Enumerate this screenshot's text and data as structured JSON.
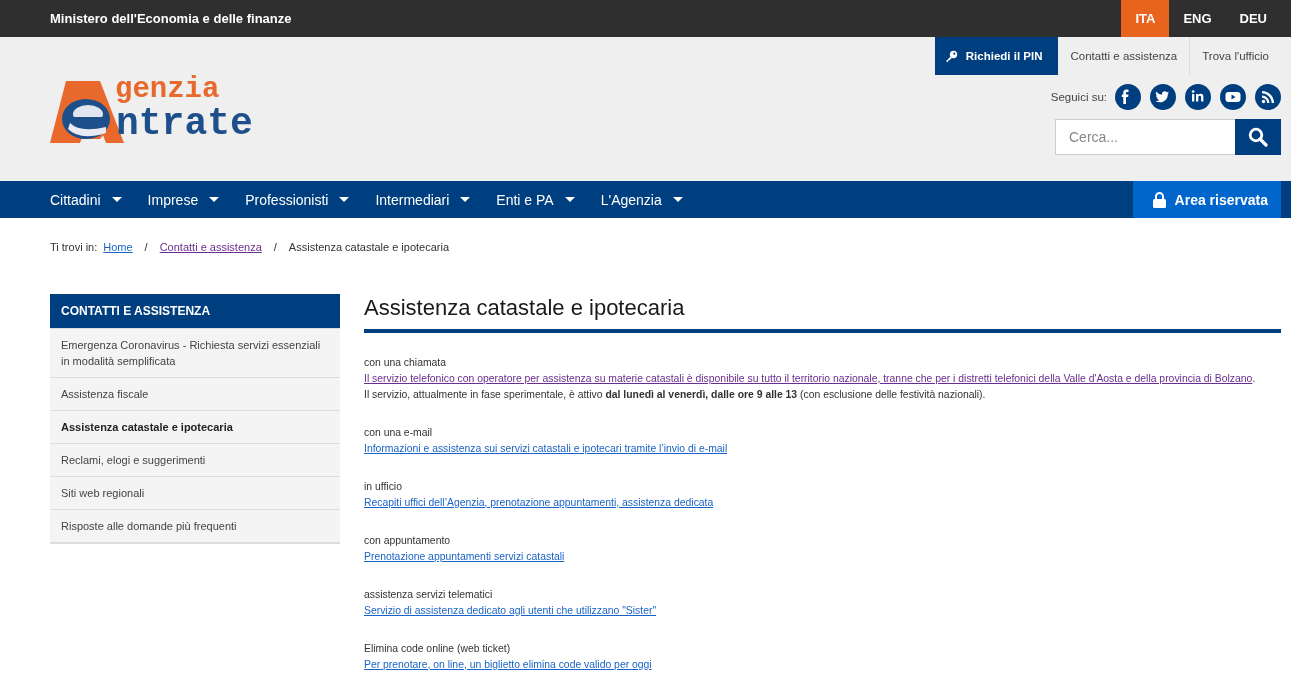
{
  "ministry": "Ministero dell'Economia e delle finanze",
  "languages": [
    {
      "label": "ITA",
      "selected": true
    },
    {
      "label": "ENG",
      "selected": false
    },
    {
      "label": "DEU",
      "selected": false
    }
  ],
  "logo": {
    "line_1": "genzia",
    "line_2": "ntrate"
  },
  "utility_links": [
    {
      "label": "Richiedi il PIN",
      "kind": "primary"
    },
    {
      "label": "Contatti e assistenza",
      "kind": "plain"
    },
    {
      "label": "Trova l'ufficio",
      "kind": "plain"
    }
  ],
  "social": {
    "label": "Seguici su:",
    "networks": [
      {
        "kind": "facebook"
      },
      {
        "kind": "twitter"
      },
      {
        "kind": "linkedin"
      },
      {
        "kind": "youtube"
      },
      {
        "kind": "rss"
      }
    ]
  },
  "search": {
    "placeholder": "Cerca..."
  },
  "nav": {
    "items": [
      {
        "label": "Cittadini"
      },
      {
        "label": "Imprese"
      },
      {
        "label": "Professionisti"
      },
      {
        "label": "Intermediari"
      },
      {
        "label": "Enti e PA"
      },
      {
        "label": "L'Agenzia"
      }
    ],
    "reserved_area": "Area riservata"
  },
  "breadcrumb": {
    "label": "Ti trovi in:",
    "items": [
      {
        "label": "Home",
        "kind": "link",
        "visited": false
      },
      {
        "label": "/",
        "kind": "separator"
      },
      {
        "label": "Contatti e assistenza",
        "kind": "link",
        "visited": true
      },
      {
        "label": "/",
        "kind": "separator"
      },
      {
        "label": "Assistenza catastale e ipotecaria",
        "kind": "current"
      }
    ]
  },
  "sidebar": {
    "title": "CONTATTI E ASSISTENZA",
    "items": [
      {
        "label": "Emergenza Coronavirus - Richiesta servizi essenziali in modalità semplificata",
        "selected": false
      },
      {
        "label": "Assistenza fiscale",
        "selected": false
      },
      {
        "label": "Assistenza catastale e ipotecaria",
        "selected": true
      },
      {
        "label": "Reclami, elogi e suggerimenti",
        "selected": false
      },
      {
        "label": "Siti web regionali",
        "selected": false
      },
      {
        "label": "Risposte alle domande più frequenti",
        "selected": false
      }
    ]
  },
  "content": {
    "title": "Assistenza catastale e ipotecaria",
    "sections": [
      {
        "label": "con una chiamata",
        "link": "Il servizio telefonico con operatore per assistenza su materie catastali è disponibile su tutto il territorio nazionale, tranne che per i distretti telefonici della Valle d'Aosta e della provincia di Bolzano",
        "link_suffix": ".",
        "visited": true,
        "note": "Il servizio, attualmente in fase sperimentale, è attivo **dal lunedì al venerdì, dalle ore 9 alle 13** (con esclusione delle festività nazionali)."
      },
      {
        "label": "con una e-mail",
        "link": "Informazioni e assistenza sui servizi catastali e ipotecari tramite l’invio di e-mail",
        "visited": false
      },
      {
        "label": "in ufficio",
        "link": "Recapiti uffici dell’Agenzia, prenotazione appuntamenti, assistenza dedicata",
        "visited": false
      },
      {
        "label": "con appuntamento",
        "link": "Prenotazione appuntamenti servizi catastali",
        "visited": false
      },
      {
        "label": "assistenza servizi telematici",
        "link": "Servizio di assistenza dedicato agli utenti che utilizzano \"Sister\"",
        "visited": false
      },
      {
        "label": "Elimina code online (web ticket)",
        "link": "Per prenotare, on line, un biglietto elimina code valido per oggi",
        "visited": false
      }
    ]
  }
}
